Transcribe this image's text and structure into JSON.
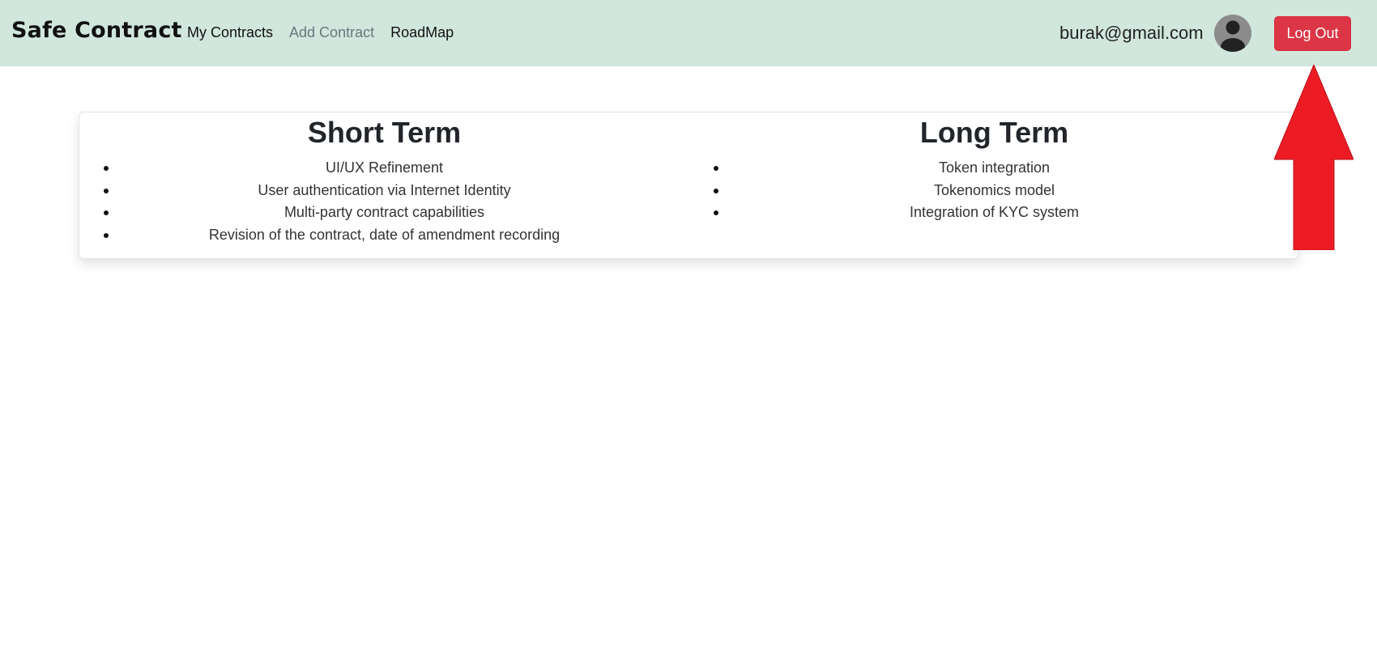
{
  "navbar": {
    "brand": "Safe Contract",
    "links": [
      {
        "label": "My Contracts",
        "muted": false
      },
      {
        "label": "Add Contract",
        "muted": true
      },
      {
        "label": "RoadMap",
        "muted": false
      }
    ],
    "user_email": "burak@gmail.com",
    "logout_label": "Log Out",
    "background": "#d1e7dd"
  },
  "roadmap": {
    "short_term": {
      "title": "Short Term",
      "items": [
        "UI/UX Refinement",
        "User authentication via Internet Identity",
        "Multi-party contract capabilities",
        "Revision of the contract, date of amendment recording"
      ]
    },
    "long_term": {
      "title": "Long Term",
      "items": [
        "Token integration",
        "Tokenomics model",
        "Integration of KYC system"
      ]
    }
  },
  "colors": {
    "logout_button": "#dc3545",
    "annotation_arrow": "#ed1c24"
  },
  "icons": {
    "avatar": "user-avatar-icon",
    "annotation": "arrow-up-icon"
  }
}
